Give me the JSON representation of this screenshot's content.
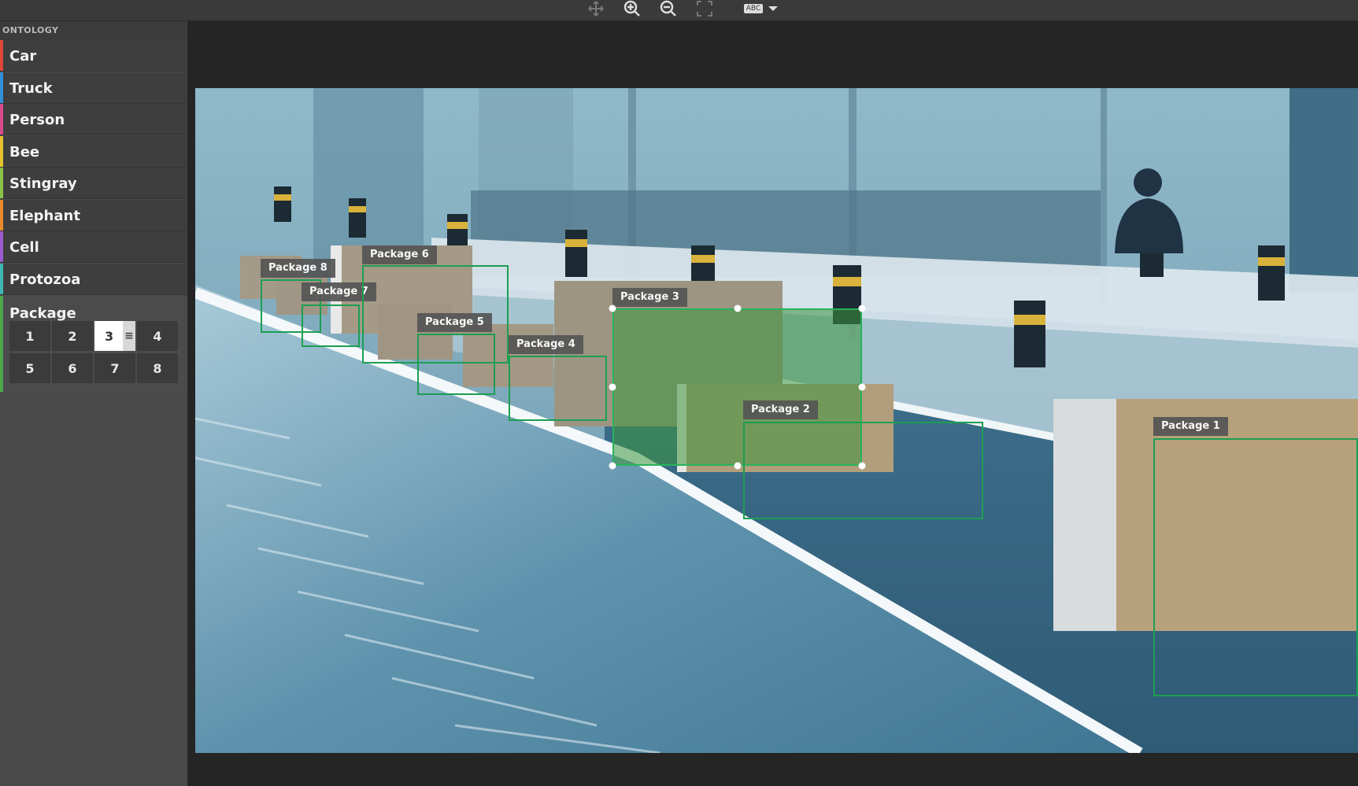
{
  "toolbar": {
    "icons": [
      "move-icon",
      "zoom-in-icon",
      "zoom-out-icon",
      "fit-screen-icon",
      "text-label-toggle-icon"
    ],
    "label_toggle_text": "ABC"
  },
  "sidebar": {
    "header": "ONTOLOGY",
    "classes": [
      {
        "label": "Car",
        "color": "#e0453a"
      },
      {
        "label": "Truck",
        "color": "#2f8fd8"
      },
      {
        "label": "Person",
        "color": "#d84a8c"
      },
      {
        "label": "Bee",
        "color": "#e6c02e"
      },
      {
        "label": "Stingray",
        "color": "#8bc34a"
      },
      {
        "label": "Elephant",
        "color": "#e88a2a"
      },
      {
        "label": "Cell",
        "color": "#9c5bd0"
      },
      {
        "label": "Protozoa",
        "color": "#3fb7b0"
      }
    ],
    "active_class": {
      "label": "Package",
      "color": "#4aa84a",
      "instances": [
        "1",
        "2",
        "3",
        "4",
        "5",
        "6",
        "7",
        "8"
      ],
      "selected_instance": "3"
    }
  },
  "annotations": [
    {
      "label": "Package 8"
    },
    {
      "label": "Package 7"
    },
    {
      "label": "Package 6"
    },
    {
      "label": "Package 5"
    },
    {
      "label": "Package 4"
    },
    {
      "label": "Package 3",
      "selected": true
    },
    {
      "label": "Package 2"
    },
    {
      "label": "Package 1"
    }
  ]
}
